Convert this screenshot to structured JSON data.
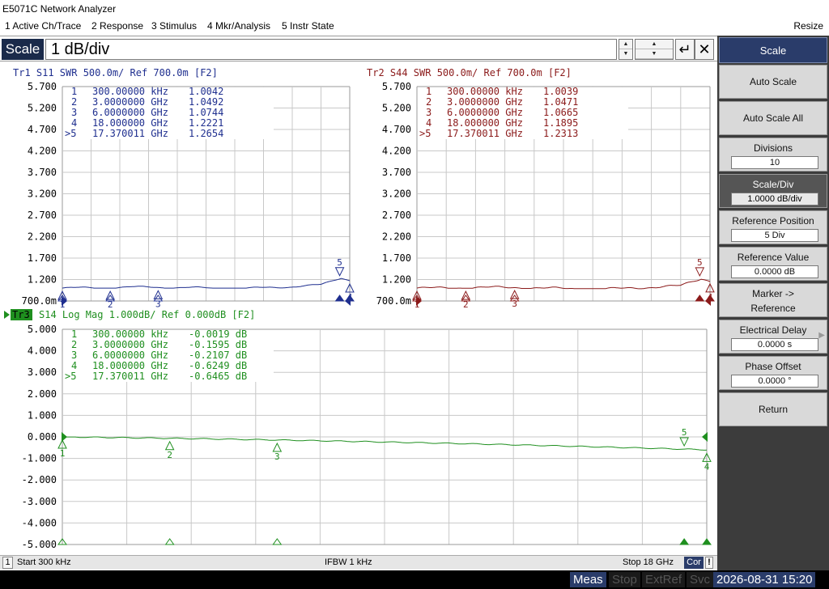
{
  "app_title": "E5071C Network Analyzer",
  "menu": [
    "1 Active Ch/Trace",
    "2 Response",
    "3 Stimulus",
    "4 Mkr/Analysis",
    "5 Instr State"
  ],
  "resize_label": "Resize",
  "entry": {
    "label": "Scale",
    "value": "1 dB/div",
    "enter_glyph": "↵",
    "close_glyph": "✕"
  },
  "softkeys": {
    "title": "Scale",
    "items": [
      {
        "label": "Auto Scale"
      },
      {
        "label": "Auto Scale All"
      },
      {
        "label": "Divisions",
        "value": "10"
      },
      {
        "label": "Scale/Div",
        "value": "1.0000 dB/div"
      },
      {
        "label": "Reference Position",
        "value": "5 Div"
      },
      {
        "label": "Reference Value",
        "value": "0.0000 dB"
      },
      {
        "label": "Marker ->",
        "label2": "Reference"
      },
      {
        "label": "Electrical Delay",
        "value": "0.0000 s"
      },
      {
        "label": "Phase Offset",
        "value": "0.0000 °"
      },
      {
        "label": "Return"
      }
    ]
  },
  "status": {
    "channel": "1",
    "start": "Start 300 kHz",
    "ifbw": "IFBW 1 kHz",
    "stop": "Stop 18 GHz",
    "cor": "Cor",
    "warn": "!"
  },
  "bottom": {
    "meas": "Meas",
    "stop": "Stop",
    "extref": "ExtRef",
    "svc": "Svc",
    "datetime": "2026-08-31 15:20"
  },
  "colors": {
    "tr1": "#1f2f8f",
    "tr2": "#8b1a1a",
    "tr3": "#1f8f1f",
    "grid": "#c8c8c8"
  },
  "traces": [
    {
      "header": "Tr1  S11  SWR 500.0m/  Ref 700.0m  [F2]",
      "yticks": [
        "5.700",
        "5.200",
        "4.700",
        "4.200",
        "3.700",
        "3.200",
        "2.700",
        "2.200",
        "1.700",
        "1.200",
        "700.0m"
      ],
      "markers": [
        {
          "idx": "1",
          "freq": "300.00000 kHz",
          "val": "1.0042"
        },
        {
          "idx": "2",
          "freq": "3.0000000 GHz",
          "val": "1.0492"
        },
        {
          "idx": "3",
          "freq": "6.0000000 GHz",
          "val": "1.0744"
        },
        {
          "idx": "4",
          "freq": "18.000000 GHz",
          "val": "1.2221"
        },
        {
          "idx": ">5",
          "freq": "17.370011 GHz",
          "val": "1.2654"
        }
      ]
    },
    {
      "header": "Tr2  S44  SWR 500.0m/  Ref 700.0m  [F2]",
      "yticks": [
        "5.700",
        "5.200",
        "4.700",
        "4.200",
        "3.700",
        "3.200",
        "2.700",
        "2.200",
        "1.700",
        "1.200",
        "700.0m"
      ],
      "markers": [
        {
          "idx": "1",
          "freq": "300.00000 kHz",
          "val": "1.0039"
        },
        {
          "idx": "2",
          "freq": "3.0000000 GHz",
          "val": "1.0471"
        },
        {
          "idx": "3",
          "freq": "6.0000000 GHz",
          "val": "1.0665"
        },
        {
          "idx": "4",
          "freq": "18.000000 GHz",
          "val": "1.1895"
        },
        {
          "idx": ">5",
          "freq": "17.370011 GHz",
          "val": "1.2313"
        }
      ]
    },
    {
      "header_tag": "Tr3",
      "header": "S14  Log Mag 1.000dB/  Ref 0.000dB  [F2]",
      "yticks": [
        "5.000",
        "4.000",
        "3.000",
        "2.000",
        "1.000",
        "0.000",
        "-1.000",
        "-2.000",
        "-3.000",
        "-4.000",
        "-5.000"
      ],
      "markers": [
        {
          "idx": "1",
          "freq": "300.00000 kHz",
          "val": "-0.0019 dB"
        },
        {
          "idx": "2",
          "freq": "3.0000000 GHz",
          "val": "-0.1595 dB"
        },
        {
          "idx": "3",
          "freq": "6.0000000 GHz",
          "val": "-0.2107 dB"
        },
        {
          "idx": "4",
          "freq": "18.000000 GHz",
          "val": "-0.6249 dB"
        },
        {
          "idx": ">5",
          "freq": "17.370011 GHz",
          "val": "-0.6465 dB"
        }
      ]
    }
  ]
}
